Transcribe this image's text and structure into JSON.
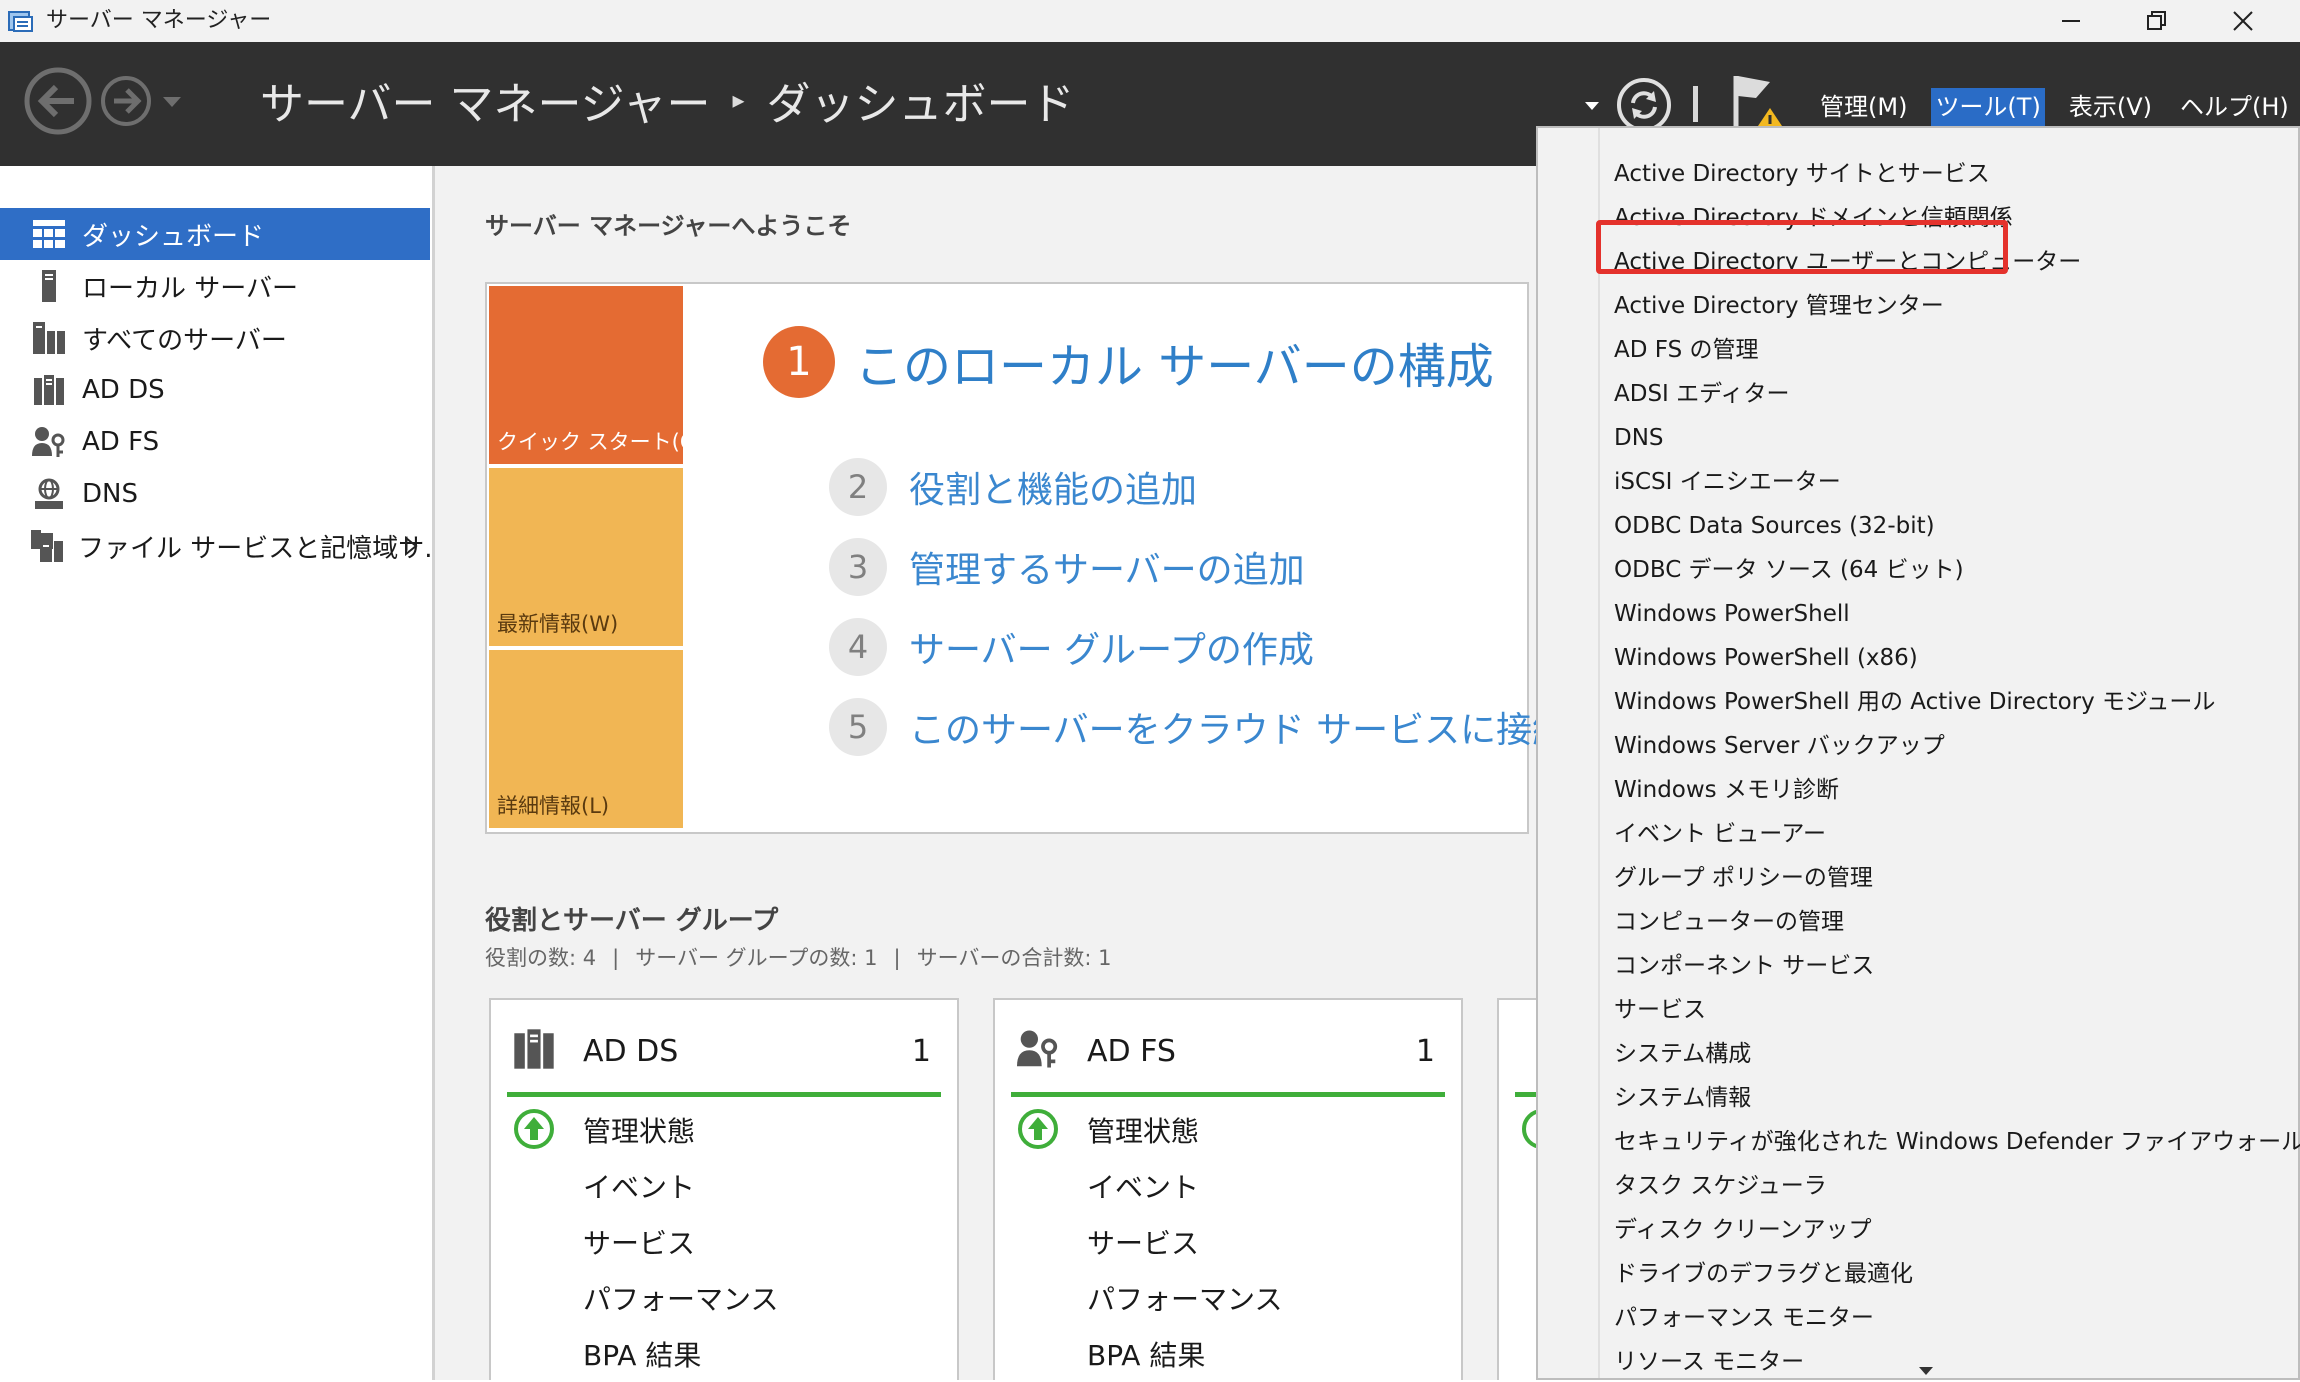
{
  "window": {
    "title": "サーバー マネージャー"
  },
  "header": {
    "breadcrumb_root": "サーバー マネージャー",
    "breadcrumb_current": "ダッシュボード",
    "menus": [
      {
        "label": "管理(M)"
      },
      {
        "label": "ツール(T)"
      },
      {
        "label": "表示(V)"
      },
      {
        "label": "ヘルプ(H)"
      }
    ]
  },
  "sidebar": {
    "items": [
      {
        "label": "ダッシュボード",
        "icon": "dashboard-icon"
      },
      {
        "label": "ローカル サーバー",
        "icon": "server-icon"
      },
      {
        "label": "すべてのサーバー",
        "icon": "servers-icon"
      },
      {
        "label": "AD DS",
        "icon": "ad-ds-icon"
      },
      {
        "label": "AD FS",
        "icon": "ad-fs-icon"
      },
      {
        "label": "DNS",
        "icon": "dns-icon"
      },
      {
        "label": "ファイル サービスと記憶域サ...",
        "icon": "file-services-icon"
      }
    ]
  },
  "main": {
    "welcome": "サーバー マネージャーへようこそ",
    "tiles": [
      {
        "label": "クイック スタート(Q)"
      },
      {
        "label": "最新情報(W)"
      },
      {
        "label": "詳細情報(L)"
      }
    ],
    "steps": [
      {
        "num": "1",
        "text": "このローカル サーバーの構成"
      },
      {
        "num": "2",
        "text": "役割と機能の追加"
      },
      {
        "num": "3",
        "text": "管理するサーバーの追加"
      },
      {
        "num": "4",
        "text": "サーバー グループの作成"
      },
      {
        "num": "5",
        "text": "このサーバーをクラウド サービスに接続する"
      }
    ],
    "roles_title": "役割とサーバー グループ",
    "roles_summary": [
      "役割の数: 4",
      "サーバー グループの数: 1",
      "サーバーの合計数: 1"
    ],
    "cards": [
      {
        "title": "AD DS",
        "count": "1",
        "rows": [
          "管理状態",
          "イベント",
          "サービス",
          "パフォーマンス",
          "BPA 結果"
        ]
      },
      {
        "title": "AD FS",
        "count": "1",
        "rows": [
          "管理状態",
          "イベント",
          "サービス",
          "パフォーマンス",
          "BPA 結果"
        ]
      }
    ]
  },
  "tools_menu": {
    "items": [
      "Active Directory サイトとサービス",
      "Active Directory ドメインと信頼関係",
      "Active Directory ユーザーとコンピューター",
      "Active Directory 管理センター",
      "AD FS の管理",
      "ADSI エディター",
      "DNS",
      "iSCSI イニシエーター",
      "ODBC Data Sources (32-bit)",
      "ODBC データ ソース (64 ビット)",
      "Windows PowerShell",
      "Windows PowerShell (x86)",
      "Windows PowerShell 用の Active Directory モジュール",
      "Windows Server バックアップ",
      "Windows メモリ診断",
      "イベント ビューアー",
      "グループ ポリシーの管理",
      "コンピューターの管理",
      "コンポーネント サービス",
      "サービス",
      "システム構成",
      "システム情報",
      "セキュリティが強化された Windows Defender ファイアウォール",
      "タスク スケジューラ",
      "ディスク クリーンアップ",
      "ドライブのデフラグと最適化",
      "パフォーマンス モニター",
      "リソース モニター"
    ],
    "highlighted_index": 2
  },
  "colors": {
    "header_bg": "#303030",
    "accent_blue": "#2f6ec6",
    "quickstart_orange": "#e46b33",
    "tile_yellow": "#f1b654",
    "status_green": "#3fae3a",
    "highlight_red": "#e4322c"
  }
}
